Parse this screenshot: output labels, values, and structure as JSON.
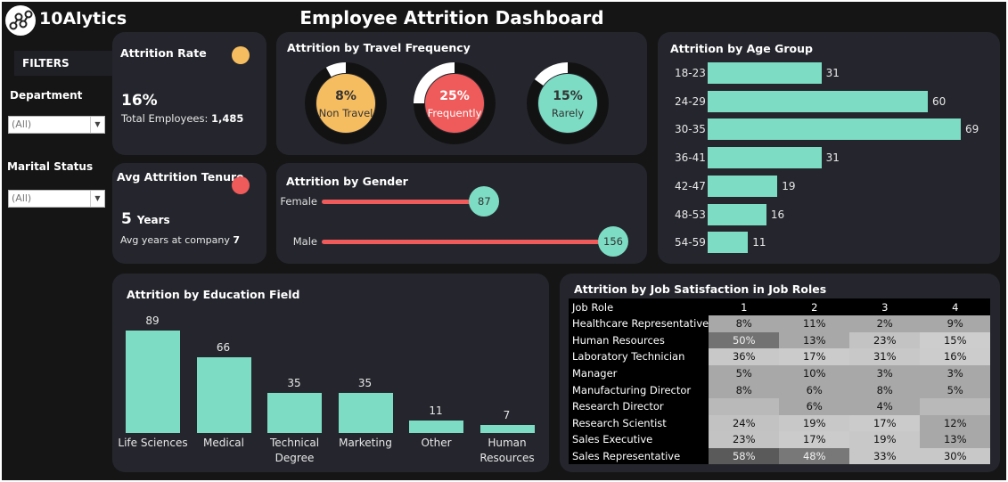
{
  "brand": {
    "name": "10Alytics"
  },
  "title": "Employee Attrition Dashboard",
  "filters": {
    "heading": "FILTERS",
    "department": {
      "label": "Department",
      "value": "(All)"
    },
    "marital_status": {
      "label": "Marital Status",
      "value": "(All)"
    }
  },
  "attrition_rate": {
    "title": "Attrition Rate",
    "value": "16%",
    "total_label": "Total Employees:",
    "total_value": "1,485",
    "dot_color": "#f6bd60"
  },
  "avg_tenure": {
    "title": "Avg Attrition Tenure",
    "value": "5",
    "unit": "Years",
    "sub_label": "Avg years at company",
    "sub_value": "7",
    "dot_color": "#ef5a5a"
  },
  "travel": {
    "title": "Attrition by Travel Frequency",
    "items": [
      {
        "pct": "8%",
        "label": "Non Travel",
        "value": 8,
        "color": "#f6bd60",
        "label_color": "#333333"
      },
      {
        "pct": "25%",
        "label": "Frequently",
        "value": 25,
        "color": "#ef5a5a",
        "label_color": "#ffffff"
      },
      {
        "pct": "15%",
        "label": "Rarely",
        "value": 15,
        "color": "#7ddcc4",
        "label_color": "#333333"
      }
    ]
  },
  "gender": {
    "title": "Attrition by Gender",
    "max": 156,
    "items": [
      {
        "label": "Female",
        "value": 87
      },
      {
        "label": "Male",
        "value": 156
      }
    ]
  },
  "age": {
    "title": "Attrition by Age Group",
    "max": 69,
    "items": [
      {
        "label": "18-23",
        "value": 31
      },
      {
        "label": "24-29",
        "value": 60
      },
      {
        "label": "30-35",
        "value": 69
      },
      {
        "label": "36-41",
        "value": 31
      },
      {
        "label": "42-47",
        "value": 19
      },
      {
        "label": "48-53",
        "value": 16
      },
      {
        "label": "54-59",
        "value": 11
      }
    ]
  },
  "education": {
    "title": "Attrition by Education Field",
    "max": 89,
    "items": [
      {
        "label": "Life Sciences",
        "value": 89
      },
      {
        "label": "Medical",
        "value": 66
      },
      {
        "label": "Technical Degree",
        "value": 35
      },
      {
        "label": "Marketing",
        "value": 35
      },
      {
        "label": "Other",
        "value": 11
      },
      {
        "label": "Human Resources",
        "value": 7
      }
    ]
  },
  "job_satisfaction": {
    "title": "Attrition by Job Satisfaction in Job Roles",
    "columns": [
      "Job Role",
      "1",
      "2",
      "3",
      "4"
    ],
    "rows": [
      {
        "role": "Healthcare Representative",
        "cells": [
          "8%",
          "11%",
          "2%",
          "9%"
        ]
      },
      {
        "role": "Human Resources",
        "cells": [
          "50%",
          "13%",
          "23%",
          "15%"
        ]
      },
      {
        "role": "Laboratory Technician",
        "cells": [
          "36%",
          "17%",
          "31%",
          "16%"
        ]
      },
      {
        "role": "Manager",
        "cells": [
          "5%",
          "10%",
          "3%",
          "3%"
        ]
      },
      {
        "role": "Manufacturing Director",
        "cells": [
          "8%",
          "6%",
          "8%",
          "5%"
        ]
      },
      {
        "role": "Research Director",
        "cells": [
          "",
          "6%",
          "4%",
          ""
        ]
      },
      {
        "role": "Research Scientist",
        "cells": [
          "24%",
          "19%",
          "17%",
          "12%"
        ]
      },
      {
        "role": "Sales Executive",
        "cells": [
          "23%",
          "17%",
          "19%",
          "13%"
        ]
      },
      {
        "role": "Sales Representative",
        "cells": [
          "58%",
          "48%",
          "33%",
          "30%"
        ]
      }
    ]
  },
  "chart_data": [
    {
      "type": "bar",
      "title": "Attrition by Age Group",
      "categories": [
        "18-23",
        "24-29",
        "30-35",
        "36-41",
        "42-47",
        "48-53",
        "54-59"
      ],
      "values": [
        31,
        60,
        69,
        31,
        19,
        16,
        11
      ]
    },
    {
      "type": "bar",
      "title": "Attrition by Education Field",
      "categories": [
        "Life Sciences",
        "Medical",
        "Technical Degree",
        "Marketing",
        "Other",
        "Human Resources"
      ],
      "values": [
        89,
        66,
        35,
        35,
        11,
        7
      ]
    },
    {
      "type": "bar",
      "title": "Attrition by Gender",
      "categories": [
        "Female",
        "Male"
      ],
      "values": [
        87,
        156
      ]
    },
    {
      "type": "pie",
      "title": "Attrition by Travel Frequency",
      "categories": [
        "Non Travel",
        "Frequently",
        "Rarely"
      ],
      "values": [
        8,
        25,
        15
      ]
    }
  ]
}
